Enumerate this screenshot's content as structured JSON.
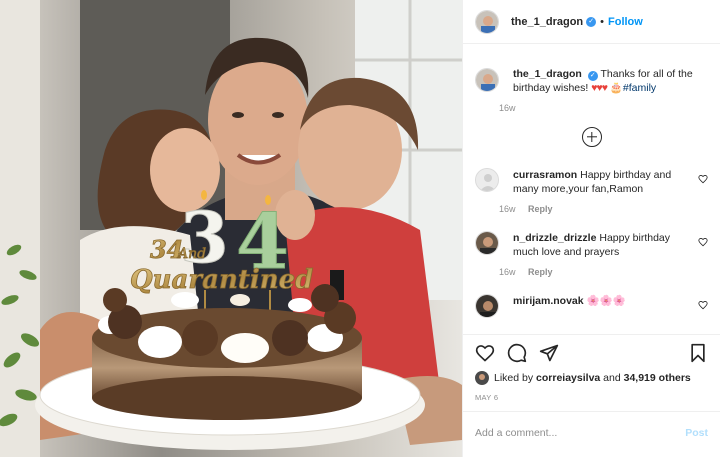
{
  "header": {
    "username": "the_1_dragon",
    "separator": "•",
    "follow_label": "Follow"
  },
  "caption": {
    "username": "the_1_dragon",
    "text": "Thanks for all of the birthday wishes!",
    "emojis": "♥♥♥",
    "hashtag": "#family",
    "age": "16w"
  },
  "photo": {
    "cake_topper_line1": "34",
    "cake_topper_and": "And",
    "cake_topper_line2": "Quarantined",
    "candle_1": "3",
    "candle_2": "4"
  },
  "comments": [
    {
      "username": "currasramon",
      "text": "Happy birthday and many more,your fan,Ramon",
      "age": "16w",
      "reply_label": "Reply"
    },
    {
      "username": "n_drizzle_drizzle",
      "text": "Happy birthday much love and prayers",
      "age": "16w",
      "reply_label": "Reply"
    },
    {
      "username": "mirijam.novak",
      "text": "🌸🌸🌸"
    }
  ],
  "likes": {
    "prefix": "Liked by",
    "user": "correiaysilva",
    "and": "and",
    "count_text": "34,919 others"
  },
  "date": "MAY 6",
  "composer": {
    "placeholder": "Add a comment...",
    "post_label": "Post"
  },
  "colors": {
    "link_blue": "#0095f6",
    "post_disabled": "#b2dffc",
    "verified_blue": "#3897f0",
    "meta_gray": "#8e8e8e"
  }
}
